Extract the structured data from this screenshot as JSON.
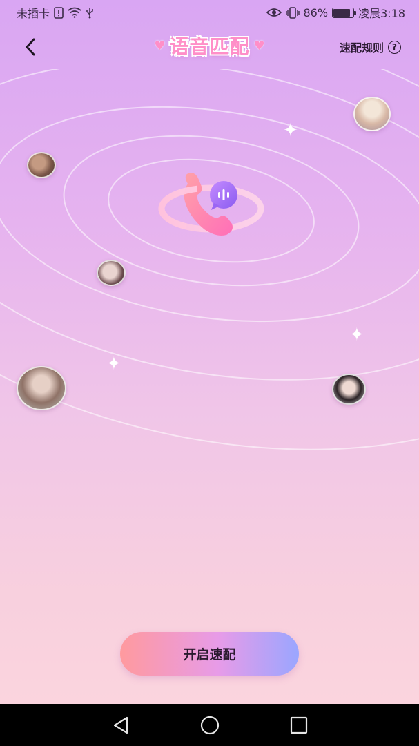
{
  "status_bar": {
    "carrier": "未插卡",
    "battery_percent": "86%",
    "battery_level": 0.86,
    "time": "凌晨3:18"
  },
  "header": {
    "title": "语音匹配",
    "rules_label": "速配规则",
    "back_icon": "chevron-left-icon",
    "help_icon": "question-circle-icon"
  },
  "main": {
    "center_icon": "phone-voice-icon",
    "start_button_label": "开启速配"
  },
  "colors": {
    "title_pink": "#ff8fc8",
    "button_start": "#ff9a9e",
    "button_mid": "#e79be8",
    "button_end": "#9aa6ff",
    "bg_top": "#d9a6f3",
    "bg_bottom": "#fcd6de"
  },
  "navbar": {
    "back_icon": "nav-back-triangle-icon",
    "home_icon": "nav-home-circle-icon",
    "recents_icon": "nav-recents-square-icon"
  }
}
